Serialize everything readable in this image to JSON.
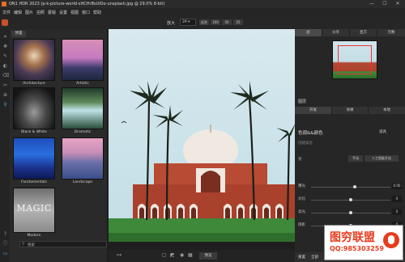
{
  "window": {
    "title": "ON1 HDR 2023 (p-k-picture-world-sHCHrBsUlDo-unsplash.jpg @ 29.0% 8-bit)",
    "min": "—",
    "max": "☐",
    "close": "✕"
  },
  "menu": [
    "文件",
    "编辑",
    "图片",
    "拍照",
    "蒙版",
    "设置",
    "视图",
    "窗口",
    "帮助"
  ],
  "toolbar": {
    "zoom_label": "放大",
    "zoom_value": "29",
    "fit_label": "适合",
    "zoom_100": "100",
    "zoom_50": "50",
    "zoom_25": "25"
  },
  "browser": {
    "tab": "预置",
    "presets": [
      "Architecture",
      "Artistic",
      "Black & White",
      "Dramatic",
      "Fundamentals",
      "Landscape",
      "Modern"
    ],
    "modern_text": "MAGIC",
    "search_placeholder": "搜索"
  },
  "bottombar": {
    "preview_button": "预览"
  },
  "right": {
    "top_tabs": [
      "层",
      "分享",
      "直方",
      "元数"
    ],
    "section_label": "图层",
    "mode_tabs": [
      "开发",
      "效果",
      "本地"
    ],
    "panel_title": "色调&&颜色",
    "reset": "道具",
    "sub_labels": [
      "创建美化",
      "亮"
    ],
    "btn_auto": "手动",
    "btn_ai": "人工智能开启",
    "sliders": [
      {
        "name": "曝光",
        "value": "0.00",
        "pos": 0.55
      },
      {
        "name": "对比",
        "value": "0",
        "pos": 0.5
      },
      {
        "name": "高光",
        "value": "0",
        "pos": 0.5
      },
      {
        "name": "阴影",
        "value": "0",
        "pos": 0.5
      }
    ],
    "bottom_buttons": [
      "重置",
      "全部",
      "设置",
      "还原",
      "合并"
    ]
  },
  "watermark": {
    "brand": "图穷联盟",
    "qq": "QQ:985303259"
  }
}
